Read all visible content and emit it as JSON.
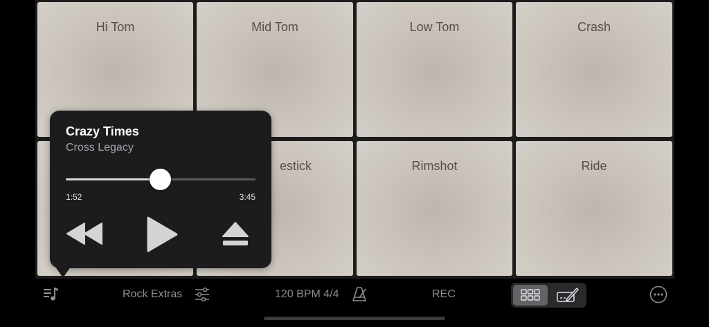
{
  "pads": [
    {
      "label": "Hi Tom"
    },
    {
      "label": "Mid Tom"
    },
    {
      "label": "Low Tom"
    },
    {
      "label": "Crash"
    },
    {
      "label": ""
    },
    {
      "label": "estick"
    },
    {
      "label": "Rimshot"
    },
    {
      "label": "Ride"
    }
  ],
  "player": {
    "title": "Crazy Times",
    "artist": "Cross Legacy",
    "elapsed": "1:52",
    "total": "3:45",
    "progress_fraction": 0.498
  },
  "bottom_bar": {
    "kit_name": "Rock Extras",
    "tempo": "120 BPM 4/4",
    "record_label": "REC"
  },
  "icons": {
    "music": "music-notes-icon",
    "kit_settings": "sliders-icon",
    "metronome": "metronome-icon",
    "grid": "grid-icon",
    "edit": "pencil-icon",
    "more": "ellipsis-icon"
  },
  "colors": {
    "pad": "#c8c2ba",
    "panel": "#1c1c1e",
    "text_dim": "#8e8e93"
  }
}
